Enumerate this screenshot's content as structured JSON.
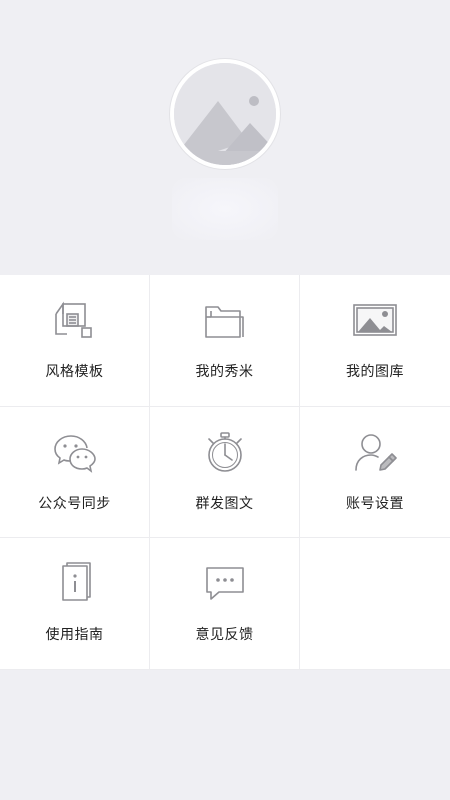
{
  "profile": {
    "username": ""
  },
  "menu": {
    "items": [
      {
        "label": "风格模板",
        "icon": "template-style-icon"
      },
      {
        "label": "我的秀米",
        "icon": "folder-icon"
      },
      {
        "label": "我的图库",
        "icon": "image-gallery-icon"
      },
      {
        "label": "公众号同步",
        "icon": "wechat-icon"
      },
      {
        "label": "群发图文",
        "icon": "stopwatch-icon"
      },
      {
        "label": "账号设置",
        "icon": "user-edit-icon"
      },
      {
        "label": "使用指南",
        "icon": "guide-book-icon"
      },
      {
        "label": "意见反馈",
        "icon": "feedback-chat-icon"
      }
    ]
  },
  "colors": {
    "background": "#efeff3",
    "cell": "#ffffff",
    "icon_stroke": "#8e8e93",
    "text": "#222222"
  }
}
